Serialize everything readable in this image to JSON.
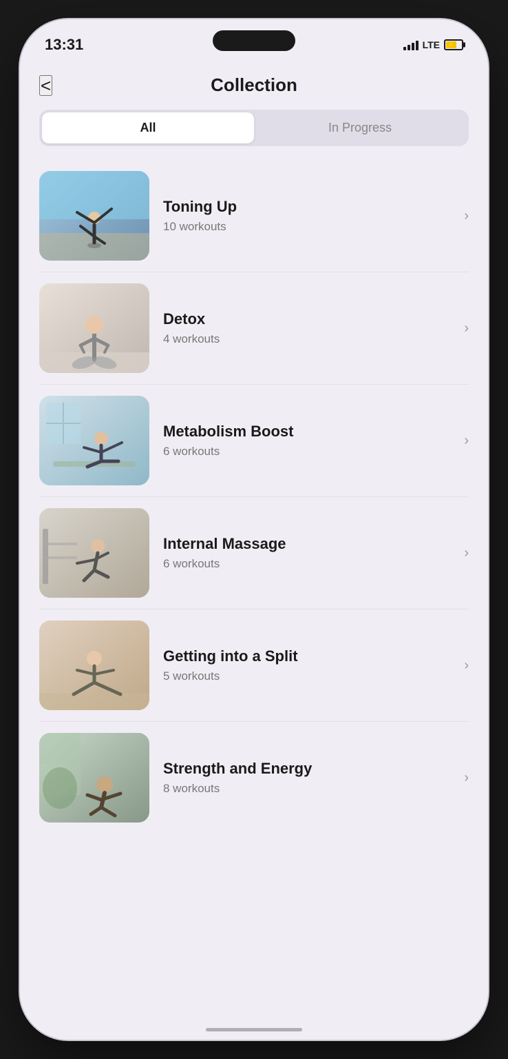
{
  "status": {
    "time": "13:31",
    "lte": "LTE"
  },
  "header": {
    "title": "Collection",
    "back_label": "<"
  },
  "tabs": [
    {
      "id": "all",
      "label": "All",
      "active": true
    },
    {
      "id": "in-progress",
      "label": "In Progress",
      "active": false
    }
  ],
  "collections": [
    {
      "id": 1,
      "name": "Toning Up",
      "count": "10 workouts",
      "color1": "#b8d4e8",
      "color2": "#8ab0c8",
      "bg": "#c5d8e8"
    },
    {
      "id": 2,
      "name": "Detox",
      "count": "4 workouts",
      "color1": "#d8d0c8",
      "color2": "#b0a898",
      "bg": "#d0c8c0"
    },
    {
      "id": 3,
      "name": "Metabolism Boost",
      "count": "6 workouts",
      "color1": "#c8d8e0",
      "color2": "#a0b8c8",
      "bg": "#c0d0d8"
    },
    {
      "id": 4,
      "name": "Internal Massage",
      "count": "6 workouts",
      "color1": "#d8d4cc",
      "color2": "#b8b0a8",
      "bg": "#ccc8c0"
    },
    {
      "id": 5,
      "name": "Getting into a Split",
      "count": "5 workouts",
      "color1": "#d8c8b8",
      "color2": "#c0a888",
      "bg": "#d0c0a8"
    },
    {
      "id": 6,
      "name": "Strength and Energy",
      "count": "8 workouts",
      "color1": "#c8d0c8",
      "color2": "#a0b0a0",
      "bg": "#c0c8b8"
    }
  ],
  "colors": {
    "accent": "#ffffff",
    "bg": "#f0eef4",
    "tab_active_bg": "#ffffff",
    "tab_inactive_bg": "#e0dde8"
  }
}
